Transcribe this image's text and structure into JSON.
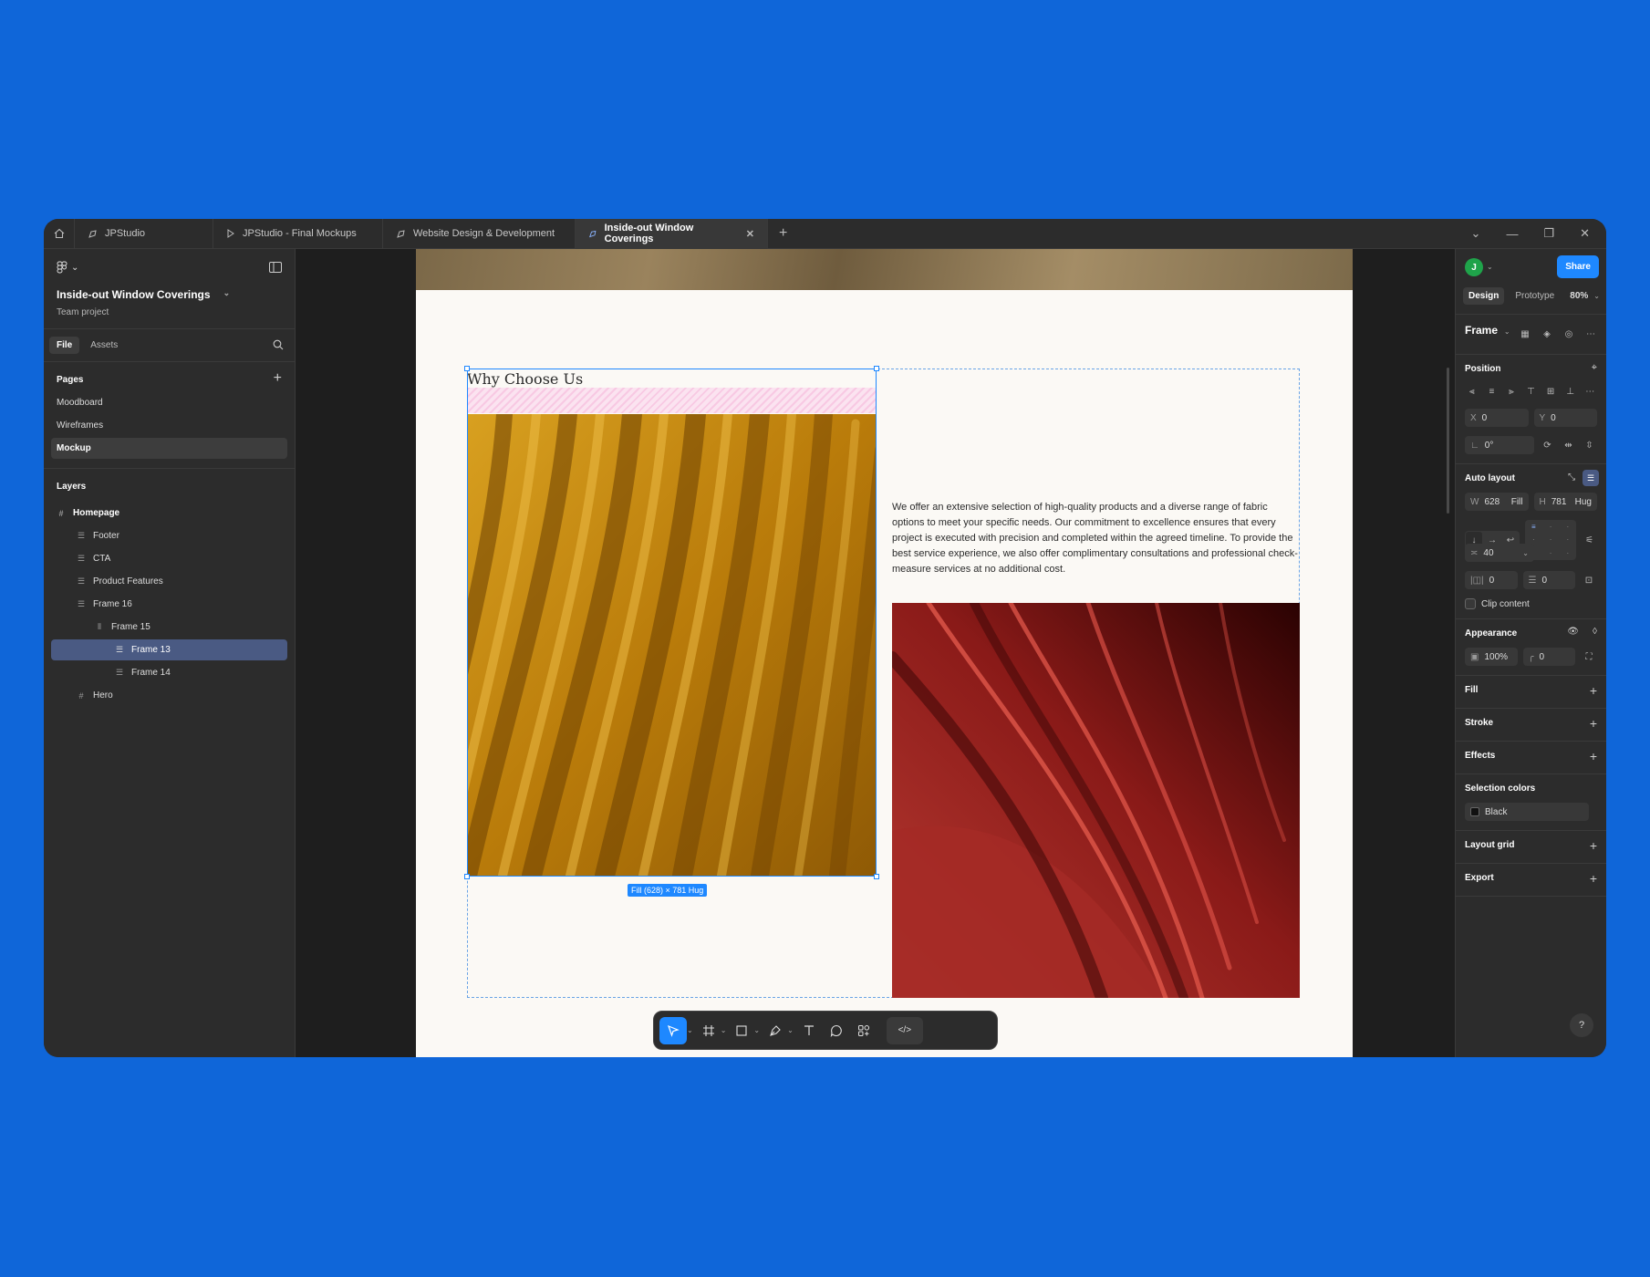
{
  "tabs": [
    {
      "label": "JPStudio",
      "icon": "figma-file-icon"
    },
    {
      "label": "JPStudio - Final Mockups",
      "icon": "play-icon"
    },
    {
      "label": "Website Design & Development",
      "icon": "figma-file-icon"
    },
    {
      "label": "Inside-out Window Coverings",
      "icon": "figma-file-icon",
      "active": true
    }
  ],
  "file": {
    "title": "Inside-out Window Coverings",
    "subtitle": "Team project"
  },
  "left_tabs": {
    "file": "File",
    "assets": "Assets"
  },
  "pages": {
    "title": "Pages",
    "items": [
      "Moodboard",
      "Wireframes",
      "Mockup"
    ],
    "active": "Mockup"
  },
  "layers": {
    "title": "Layers",
    "items": [
      {
        "label": "Homepage",
        "depth": 0,
        "icon": "frame-icon"
      },
      {
        "label": "Footer",
        "depth": 1,
        "icon": "autolayout-icon"
      },
      {
        "label": "CTA",
        "depth": 1,
        "icon": "autolayout-icon"
      },
      {
        "label": "Product Features",
        "depth": 1,
        "icon": "autolayout-icon"
      },
      {
        "label": "Frame 16",
        "depth": 1,
        "icon": "autolayout-icon"
      },
      {
        "label": "Frame 15",
        "depth": 2,
        "icon": "autolayout-horizontal-icon"
      },
      {
        "label": "Frame 13",
        "depth": 3,
        "icon": "autolayout-icon",
        "active": true
      },
      {
        "label": "Frame 14",
        "depth": 3,
        "icon": "autolayout-icon"
      },
      {
        "label": "Hero",
        "depth": 1,
        "icon": "frame-icon"
      }
    ]
  },
  "canvas": {
    "heading": "Why Choose Us",
    "body": "We offer an extensive selection of high-quality products and a diverse range of fabric options to meet your specific needs. Our commitment to excellence ensures that every project is executed with precision and completed within the agreed timeline. To provide the best service experience, we also offer complimentary consultations and professional check-measure services at no additional cost.",
    "dimension_badge": "Fill (628) × 781 Hug"
  },
  "right": {
    "avatar": "J",
    "share": "Share",
    "tabs": {
      "design": "Design",
      "prototype": "Prototype"
    },
    "zoom": "80%",
    "frame_label": "Frame",
    "position": {
      "title": "Position",
      "x_label": "X",
      "x": "0",
      "y_label": "Y",
      "y": "0",
      "rotation": "0°"
    },
    "auto_layout": {
      "title": "Auto layout",
      "w_label": "W",
      "w": "628",
      "w_mode": "Fill",
      "h_label": "H",
      "h": "781",
      "h_mode": "Hug",
      "gap": "40",
      "padding_h": "0",
      "padding_v": "0",
      "clip": "Clip content"
    },
    "appearance": {
      "title": "Appearance",
      "opacity": "100%",
      "radius": "0"
    },
    "fill": "Fill",
    "stroke": "Stroke",
    "effects": "Effects",
    "selection_colors": {
      "title": "Selection colors",
      "color": "Black"
    },
    "layout_grid": "Layout grid",
    "export": "Export",
    "help": "?"
  },
  "colors": {
    "accent": "#1E88FF",
    "background": "#0F66D9",
    "selection_layer": "#4A5A83"
  }
}
